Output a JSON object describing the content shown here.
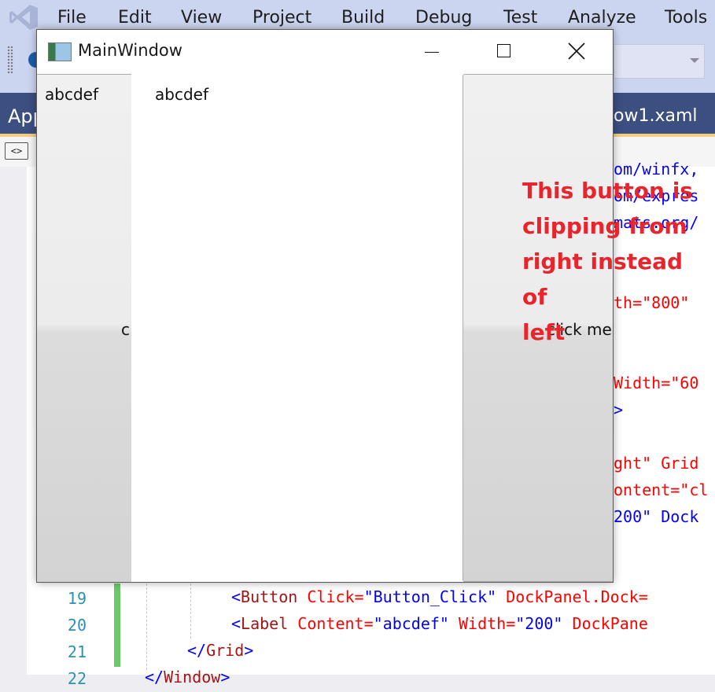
{
  "vs": {
    "menu": [
      "File",
      "Edit",
      "View",
      "Project",
      "Build",
      "Debug",
      "Test",
      "Analyze",
      "Tools"
    ],
    "tab_left": "App",
    "tab_right": "ow1.xaml",
    "xml_toggle": "<>",
    "code_right_lines": [
      "om/winfx,",
      "om/expres",
      "mats.org/",
      "th=\"800\"",
      "Width=\"60",
      ">",
      "ght\" Grid",
      "ontent=\"cl",
      "200\" Dock"
    ],
    "line_numbers": [
      "19",
      "20",
      "21",
      "22"
    ],
    "code_bottom": [
      {
        "tag_open": "<",
        "tag": "Button",
        "attr1": " Click=",
        "val1": "\"Button_Click\"",
        "attr2": " DockPanel.Dock="
      },
      {
        "tag_open": "<",
        "tag": "Label",
        "attr1": " Content=",
        "val1": "\"abcdef\"",
        "attr2": " Width=",
        "val2": "\"200\"",
        "attr3": " DockPane"
      },
      {
        "tag_open": "</",
        "tag": "Grid",
        "tag_close": ">"
      },
      {
        "tag_open": "</",
        "tag": "Window",
        "tag_close": ">"
      }
    ]
  },
  "window": {
    "title": "MainWindow",
    "label_left": "abcdef",
    "label_right": "abcdef",
    "button_left_caption": "c",
    "button_right_caption": "click me"
  },
  "annotation": {
    "text_lines": [
      "This button is",
      "clipping from",
      "right instead of",
      "left"
    ],
    "color": "#e8242c"
  },
  "colors": {
    "menubar": "#ccd5f0",
    "tabstrip": "#3b4f81",
    "change_bar": "#6cc868"
  }
}
